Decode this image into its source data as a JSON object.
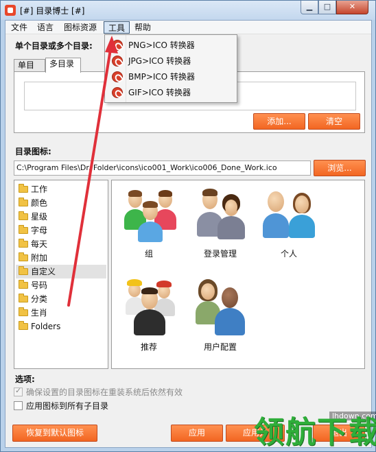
{
  "window": {
    "title": "[#] 目录博士 [#]",
    "min_glyph": "▁",
    "max_glyph": "□",
    "close_glyph": "✕"
  },
  "menubar": {
    "items": [
      "文件",
      "语言",
      "图标资源",
      "工具",
      "帮助"
    ],
    "active": "工具"
  },
  "tools_menu": {
    "items": [
      "PNG>ICO 转换器",
      "JPG>ICO 转换器",
      "BMP>ICO 转换器",
      "GIF>ICO 转换器"
    ]
  },
  "mode_label": "单个目录或多个目录:",
  "tabs": [
    "单目录",
    "多目录"
  ],
  "active_tab": "多目录",
  "folder_buttons": {
    "add": "添加...",
    "clear": "清空"
  },
  "icon_section": {
    "label": "目录图标:",
    "path": "C:\\Program Files\\Dr. Folder\\icons\\ico001_Work\\ico006_Done_Work.ico",
    "browse": "浏览..."
  },
  "categories": [
    "工作",
    "颜色",
    "星级",
    "字母",
    "每天",
    "附加",
    "自定义",
    "号码",
    "分类",
    "生肖",
    "Folders"
  ],
  "selected_category": "自定义",
  "icons": [
    "组",
    "登录管理",
    "个人",
    "推荐",
    "用户配置"
  ],
  "options": {
    "label": "选项:",
    "keep_after_reinstall": "确保设置的目录图标在重装系统后依然有效",
    "keep_after_reinstall_checked": true,
    "apply_to_subfolders": "应用图标到所有子目录",
    "apply_to_subfolders_checked": false
  },
  "bottom_buttons": {
    "restore": "恢复到默认图标",
    "apply": "应用",
    "apply_close": "应用并",
    "exit": "退出"
  },
  "watermark": {
    "site": "lhdown.com",
    "brand": "领航下载"
  },
  "colors": {
    "accent_button": "#f26622",
    "annotation_arrow": "#e0303a",
    "watermark_green": "#2fae3a"
  }
}
